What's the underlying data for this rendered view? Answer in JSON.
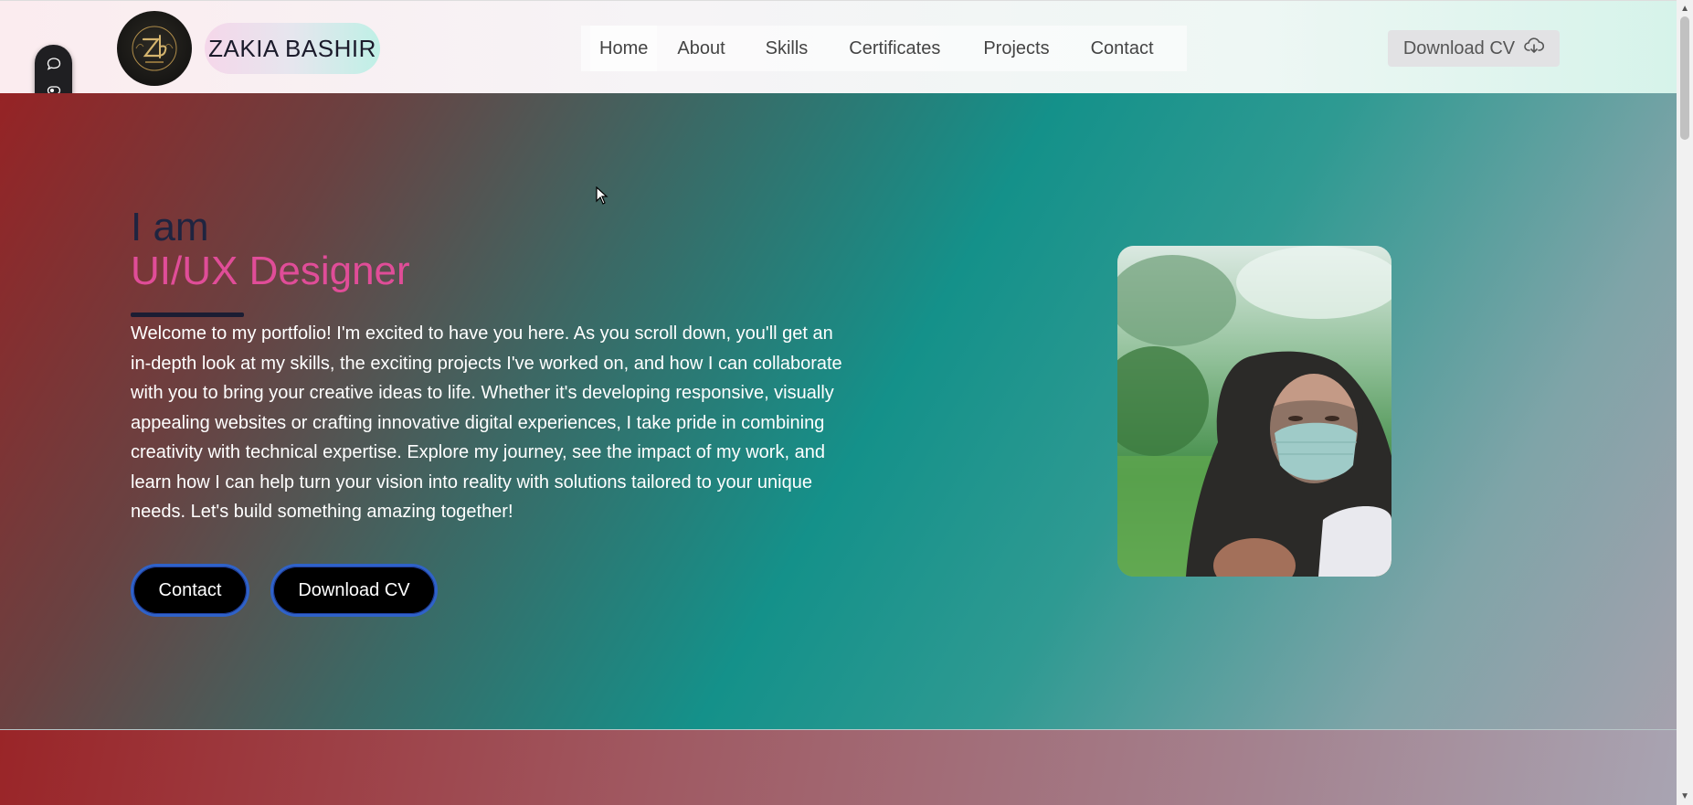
{
  "header": {
    "brand_name": "ZAKIA BASHIR",
    "nav": [
      "Home",
      "About",
      "Skills",
      "Certificates",
      "Projects",
      "Contact"
    ],
    "download_cv": "Download CV",
    "logo_icon": "zb-monogram-logo",
    "cv_icon": "cloud-download-icon"
  },
  "sidetool": {
    "icons": [
      "chat-bubble-icon",
      "eye-toggle-icon",
      "menu-list-icon"
    ]
  },
  "hero": {
    "greeting": "I am",
    "role": "UI/UX Designer",
    "intro": "Welcome to my portfolio! I'm excited to have you here. As you scroll down, you'll get an in-depth look at my skills, the exciting projects I've worked on, and how I can collaborate with you to bring your creative ideas to life. Whether it's developing responsive, visually appealing websites or crafting innovative digital experiences, I take pride in combining creativity with technical expertise. Explore my journey, see the impact of my work, and learn how I can help turn your vision into reality with solutions tailored to your unique needs. Let's build something amazing together!",
    "buttons": {
      "contact": "Contact",
      "download_cv": "Download CV"
    }
  },
  "colors": {
    "role_accent": "#e04d98",
    "button_bg": "#000000",
    "button_border": "#2f62c9"
  }
}
